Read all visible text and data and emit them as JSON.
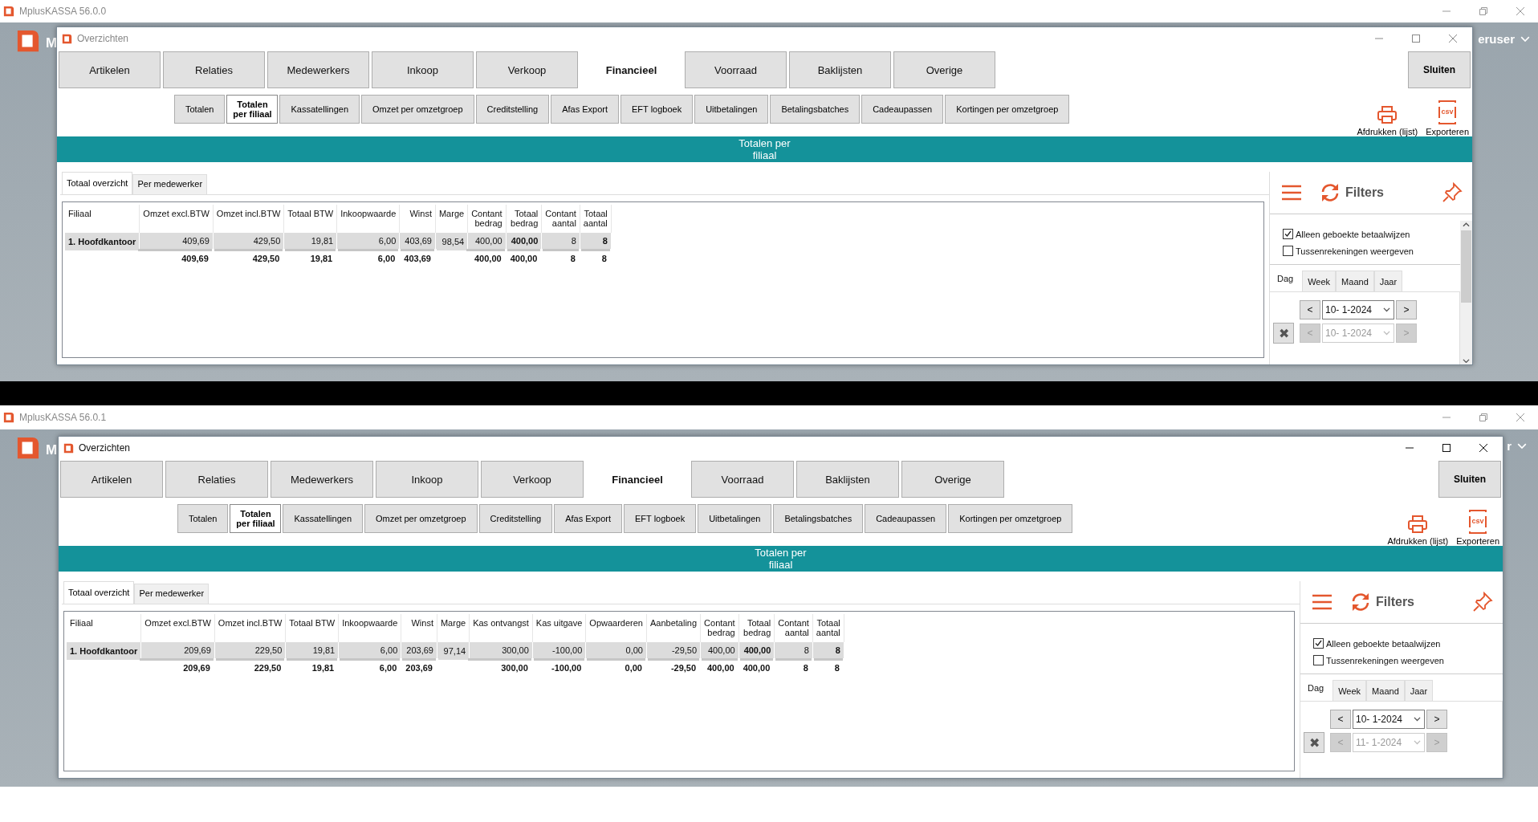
{
  "screens": [
    {
      "app_title": "MplusKASSA 56.0.0",
      "app_name": "M",
      "user_label": "eruser",
      "dialog": {
        "title": "Overzichten",
        "active": false,
        "main_tabs": [
          {
            "label": "Artikelen",
            "selected": false
          },
          {
            "label": "Relaties",
            "selected": false
          },
          {
            "label": "Medewerkers",
            "selected": false
          },
          {
            "label": "Inkoop",
            "selected": false
          },
          {
            "label": "Verkoop",
            "selected": false
          },
          {
            "label": "Financieel",
            "selected": true
          },
          {
            "label": "Voorraad",
            "selected": false
          },
          {
            "label": "Baklijsten",
            "selected": false
          },
          {
            "label": "Overige",
            "selected": false
          }
        ],
        "close_button": "Sluiten",
        "sub_tabs": [
          {
            "label": "Totalen",
            "selected": false
          },
          {
            "label": "Totalen per filiaal",
            "selected": true
          },
          {
            "label": "Kassatellingen",
            "selected": false
          },
          {
            "label": "Omzet per omzetgroep",
            "selected": false
          },
          {
            "label": "Creditstelling",
            "selected": false
          },
          {
            "label": "Afas Export",
            "selected": false
          },
          {
            "label": "EFT logboek",
            "selected": false
          },
          {
            "label": "Uitbetalingen",
            "selected": false
          },
          {
            "label": "Betalingsbatches",
            "selected": false
          },
          {
            "label": "Cadeaupassen",
            "selected": false
          },
          {
            "label": "Kortingen per omzetgroep",
            "selected": false
          }
        ],
        "actions": [
          {
            "kind": "print",
            "label": "Afdrukken (lijst)"
          },
          {
            "kind": "csv",
            "label": "Exporteren",
            "icon_text": "csv"
          }
        ],
        "banner": "Totalen per filiaal",
        "view_tabs": [
          {
            "label": "Totaal overzicht",
            "selected": true
          },
          {
            "label": "Per medewerker",
            "selected": false
          }
        ],
        "table": {
          "columns": [
            {
              "label": "Filiaal",
              "kind": "text",
              "bold": true,
              "stacked": false
            },
            {
              "label": "Omzet excl.BTW",
              "kind": "number",
              "bold": false,
              "stacked": false,
              "total": "409,69"
            },
            {
              "label": "Omzet incl.BTW",
              "kind": "number",
              "bold": false,
              "stacked": false,
              "total": "429,50"
            },
            {
              "label": "Totaal BTW",
              "kind": "number",
              "bold": false,
              "stacked": false,
              "total": "19,81"
            },
            {
              "label": "Inkoopwaarde",
              "kind": "number",
              "bold": false,
              "stacked": false,
              "total": "6,00"
            },
            {
              "label": "Winst",
              "kind": "number",
              "bold": false,
              "stacked": false,
              "total": "403,69"
            },
            {
              "label": "Marge",
              "kind": "number",
              "bold": false,
              "stacked": false
            },
            {
              "label": "Contant bedrag",
              "kind": "number",
              "bold": false,
              "stacked": true,
              "total": "400,00"
            },
            {
              "label": "Totaal bedrag",
              "kind": "number",
              "bold": true,
              "stacked": true,
              "total": "400,00"
            },
            {
              "label": "Contant aantal",
              "kind": "number",
              "bold": false,
              "stacked": true,
              "total": "8"
            },
            {
              "label": "Totaal aantal",
              "kind": "number",
              "bold": true,
              "stacked": true,
              "total": "8"
            }
          ],
          "rows": [
            {
              "selected": true,
              "cells": [
                "1. Hoofdkantoor",
                "409,69",
                "429,50",
                "19,81",
                "6,00",
                "403,69",
                "98,54",
                "400,00",
                "400,00",
                "8",
                "8"
              ]
            }
          ]
        },
        "filters": {
          "title": "Filters",
          "scrollbar": true,
          "options": [
            {
              "label": "Alleen geboekte betaalwijzen",
              "checked": true
            },
            {
              "label": "Tussenrekeningen weergeven",
              "checked": false
            }
          ],
          "period_tabs": [
            {
              "label": "Dag",
              "selected": true
            },
            {
              "label": "Week",
              "selected": false
            },
            {
              "label": "Maand",
              "selected": false
            },
            {
              "label": "Jaar",
              "selected": false
            }
          ],
          "clear": "✖",
          "dates": [
            {
              "prev": "<",
              "value": "10- 1-2024",
              "next": ">",
              "disabled": false
            },
            {
              "prev": "<",
              "value": "10- 1-2024",
              "next": ">",
              "disabled": true
            }
          ]
        }
      }
    },
    {
      "app_title": "MplusKASSA 56.0.1",
      "app_name": "M",
      "user_label": "r",
      "dialog": {
        "title": "Overzichten",
        "active": true,
        "main_tabs": [
          {
            "label": "Artikelen",
            "selected": false
          },
          {
            "label": "Relaties",
            "selected": false
          },
          {
            "label": "Medewerkers",
            "selected": false
          },
          {
            "label": "Inkoop",
            "selected": false
          },
          {
            "label": "Verkoop",
            "selected": false
          },
          {
            "label": "Financieel",
            "selected": true
          },
          {
            "label": "Voorraad",
            "selected": false
          },
          {
            "label": "Baklijsten",
            "selected": false
          },
          {
            "label": "Overige",
            "selected": false
          }
        ],
        "close_button": "Sluiten",
        "sub_tabs": [
          {
            "label": "Totalen",
            "selected": false
          },
          {
            "label": "Totalen per filiaal",
            "selected": true
          },
          {
            "label": "Kassatellingen",
            "selected": false
          },
          {
            "label": "Omzet per omzetgroep",
            "selected": false
          },
          {
            "label": "Creditstelling",
            "selected": false
          },
          {
            "label": "Afas Export",
            "selected": false
          },
          {
            "label": "EFT logboek",
            "selected": false
          },
          {
            "label": "Uitbetalingen",
            "selected": false
          },
          {
            "label": "Betalingsbatches",
            "selected": false
          },
          {
            "label": "Cadeaupassen",
            "selected": false
          },
          {
            "label": "Kortingen per omzetgroep",
            "selected": false
          }
        ],
        "actions": [
          {
            "kind": "print",
            "label": "Afdrukken (lijst)"
          },
          {
            "kind": "csv",
            "label": "Exporteren",
            "icon_text": "csv"
          }
        ],
        "banner": "Totalen per filiaal",
        "view_tabs": [
          {
            "label": "Totaal overzicht",
            "selected": true
          },
          {
            "label": "Per medewerker",
            "selected": false
          }
        ],
        "table": {
          "columns": [
            {
              "label": "Filiaal",
              "kind": "text",
              "bold": true,
              "stacked": false
            },
            {
              "label": "Omzet excl.BTW",
              "kind": "number",
              "bold": false,
              "stacked": false,
              "total": "209,69"
            },
            {
              "label": "Omzet incl.BTW",
              "kind": "number",
              "bold": false,
              "stacked": false,
              "total": "229,50"
            },
            {
              "label": "Totaal BTW",
              "kind": "number",
              "bold": false,
              "stacked": false,
              "total": "19,81"
            },
            {
              "label": "Inkoopwaarde",
              "kind": "number",
              "bold": false,
              "stacked": false,
              "total": "6,00"
            },
            {
              "label": "Winst",
              "kind": "number",
              "bold": false,
              "stacked": false,
              "total": "203,69"
            },
            {
              "label": "Marge",
              "kind": "number",
              "bold": false,
              "stacked": false
            },
            {
              "label": "Kas ontvangst",
              "kind": "number",
              "bold": false,
              "stacked": false,
              "total": "300,00"
            },
            {
              "label": "Kas uitgave",
              "kind": "number",
              "bold": false,
              "stacked": false,
              "total": "-100,00"
            },
            {
              "label": "Opwaarderen",
              "kind": "number",
              "bold": false,
              "stacked": false,
              "total": "0,00"
            },
            {
              "label": "Aanbetaling",
              "kind": "number",
              "bold": false,
              "stacked": false,
              "total": "-29,50"
            },
            {
              "label": "Contant bedrag",
              "kind": "number",
              "bold": false,
              "stacked": true,
              "total": "400,00"
            },
            {
              "label": "Totaal bedrag",
              "kind": "number",
              "bold": true,
              "stacked": true,
              "total": "400,00"
            },
            {
              "label": "Contant aantal",
              "kind": "number",
              "bold": false,
              "stacked": true,
              "total": "8"
            },
            {
              "label": "Totaal aantal",
              "kind": "number",
              "bold": true,
              "stacked": true,
              "total": "8"
            }
          ],
          "rows": [
            {
              "selected": true,
              "cells": [
                "1. Hoofdkantoor",
                "209,69",
                "229,50",
                "19,81",
                "6,00",
                "203,69",
                "97,14",
                "300,00",
                "-100,00",
                "0,00",
                "-29,50",
                "400,00",
                "400,00",
                "8",
                "8"
              ]
            }
          ]
        },
        "filters": {
          "title": "Filters",
          "options": [
            {
              "label": "Alleen geboekte betaalwijzen",
              "checked": true
            },
            {
              "label": "Tussenrekeningen weergeven",
              "checked": false
            }
          ],
          "period_tabs": [
            {
              "label": "Dag",
              "selected": true
            },
            {
              "label": "Week",
              "selected": false
            },
            {
              "label": "Maand",
              "selected": false
            },
            {
              "label": "Jaar",
              "selected": false
            }
          ],
          "clear": "✖",
          "dates": [
            {
              "prev": "<",
              "value": "10- 1-2024",
              "next": ">",
              "disabled": false
            },
            {
              "prev": "<",
              "value": "11- 1-2024",
              "next": ">",
              "disabled": true
            }
          ]
        }
      }
    }
  ]
}
